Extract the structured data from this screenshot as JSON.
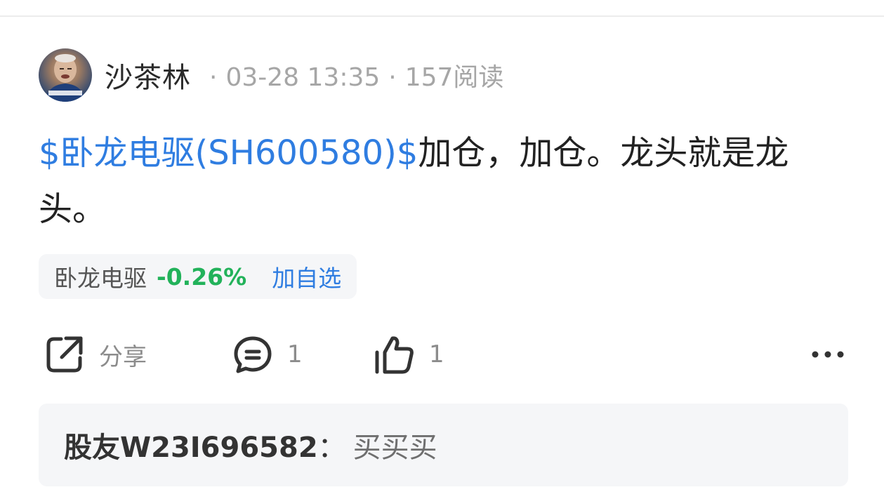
{
  "post": {
    "author": "沙茶林",
    "date": "03-28 13:35",
    "reads": "157阅读",
    "dot": "·",
    "stock_link": "$卧龙电驱(SH600580)$",
    "text": "加仓，加仓。龙头就是龙头。"
  },
  "stock_chip": {
    "name": "卧龙电驱",
    "change": "-0.26%",
    "add_label": "加自选",
    "change_color": "#22b25a"
  },
  "actions": {
    "share_label": "分享",
    "comment_count": "1",
    "like_count": "1",
    "share_icon": "share-icon",
    "comment_icon": "comment-icon",
    "like_icon": "thumbs-up-icon",
    "more_icon": "more-icon"
  },
  "comment": {
    "commenter": "股友W23I696582",
    "separator": "：",
    "text": "买买买"
  },
  "colors": {
    "link": "#2f7de1",
    "muted": "#a6a6a6",
    "chip_bg": "#f5f6f8"
  }
}
